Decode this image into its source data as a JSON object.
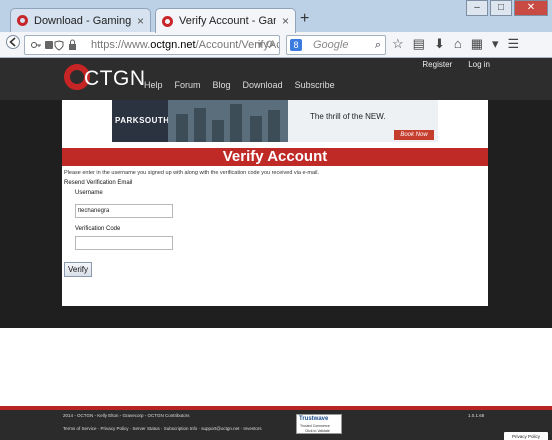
{
  "browser": {
    "tabs": [
      {
        "title": "Download - Gaming Platfo..."
      },
      {
        "title": "Verify Account - Gaming P..."
      }
    ],
    "url_prefix": "https://www.",
    "url_host": "octgn.net",
    "url_path": "/Account/VerifyAccour",
    "search_placeholder": "Google",
    "search_engine_badge": "8",
    "new_tab_label": "+",
    "close_tab_glyph": "×",
    "window_buttons": [
      "–",
      "□",
      "✕"
    ],
    "nav_icons": [
      "back-icon",
      "key-icon",
      "pocket-icon",
      "shield-icon",
      "refresh-icon",
      "search-icon",
      "star-icon",
      "reading-list-icon",
      "download-icon",
      "home-icon",
      "extension-icon",
      "menu-icon"
    ]
  },
  "site": {
    "logo_text": "CTGN",
    "top_links": [
      "Register",
      "Log in"
    ],
    "nav": [
      "Help",
      "Forum",
      "Blog",
      "Download",
      "Subscribe"
    ],
    "brand_color": "#c72525"
  },
  "banner": {
    "brand": "PARKSOUTH",
    "tagline": "The thrill of the NEW.",
    "cta": "Book Now"
  },
  "main": {
    "title": "Verify Account",
    "intro": "Please enter in the username you signed up with along with the verification code you received via e-mail.",
    "section_label": "Resend Verification Email",
    "username_label": "Username",
    "username_value": "flechanegra",
    "code_label": "Verification Code",
    "code_value": "",
    "submit_label": "Verify"
  },
  "footer": {
    "copyright": "2014 - OCTGN - Kelly Elton - Gravecorp - OCTGN Contributors",
    "links": "Terms of Service  ·  Privacy Policy  ·  Server Status  ·  Subscription Info  ·  support@octgn.net  ·  Investors",
    "version": "1.0.1.68",
    "trust_title": "Trustwave",
    "trust_sub": "Trusted Commerce",
    "trust_click": "Click to Validate",
    "privacy_label": "Privacy Policy"
  }
}
